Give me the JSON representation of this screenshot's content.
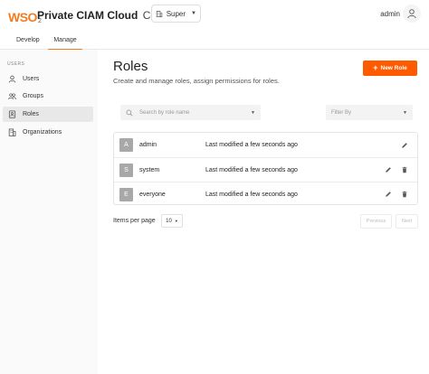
{
  "header": {
    "logo_text": "WSO",
    "logo_sub": "2",
    "product_name": "Private CIAM Cloud",
    "product_suffix": "Console",
    "org_switcher": "Super",
    "user_name": "admin"
  },
  "tabs": [
    {
      "label": "Develop",
      "active": false
    },
    {
      "label": "Manage",
      "active": true
    }
  ],
  "sidebar": {
    "section_heading": "USERS",
    "items": [
      {
        "label": "Users",
        "icon": "user-icon",
        "active": false
      },
      {
        "label": "Groups",
        "icon": "groups-icon",
        "active": false
      },
      {
        "label": "Roles",
        "icon": "roles-icon",
        "active": true
      },
      {
        "label": "Organizations",
        "icon": "organizations-icon",
        "active": false
      }
    ]
  },
  "page": {
    "title": "Roles",
    "subtitle": "Create and manage roles, assign permissions for roles.",
    "new_button": "New Role",
    "search_placeholder": "Search by role name",
    "filter_placeholder": "Filter By"
  },
  "roles": [
    {
      "initial": "A",
      "name": "admin",
      "modified": "Last modified a few seconds ago",
      "deletable": false
    },
    {
      "initial": "S",
      "name": "system",
      "modified": "Last modified a few seconds ago",
      "deletable": true
    },
    {
      "initial": "E",
      "name": "everyone",
      "modified": "Last modified a few seconds ago",
      "deletable": true
    }
  ],
  "pagination": {
    "items_per_page_label": "Items per page",
    "items_per_page_value": "10",
    "previous": "Previous",
    "next": "Next"
  },
  "colors": {
    "accent": "#ff5a00",
    "brand": "#f47b20"
  }
}
